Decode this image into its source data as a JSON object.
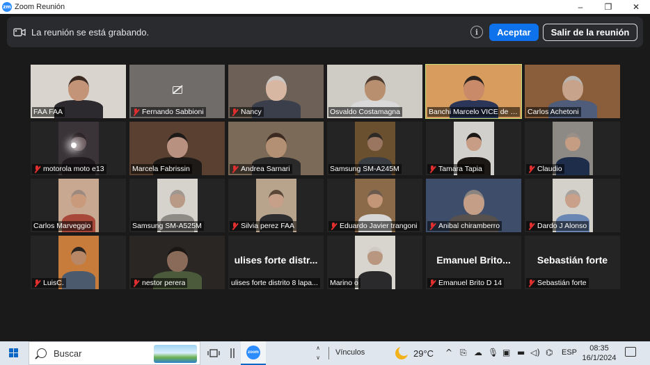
{
  "window": {
    "logo_text": "zm",
    "title": "Zoom Reunión",
    "controls": [
      "–",
      "❐",
      "✕"
    ]
  },
  "recording_bar": {
    "message": "La reunión se está grabando.",
    "info_symbol": "i",
    "accept_label": "Aceptar",
    "leave_label": "Salir de la reunión"
  },
  "participants": [
    {
      "name": "FAA FAA",
      "muted": false,
      "bg": "#d9d4cd",
      "skin": "#c49478",
      "hair": "#3a2a22",
      "shirt": "#2c2a2e"
    },
    {
      "name": "Fernando Sabbioni",
      "muted": true,
      "video_off": true
    },
    {
      "name": "Nancy",
      "muted": true,
      "bg": "#6d6056",
      "skin": "#d7b7a2",
      "hair": "#c9c5c2",
      "shirt": "#3a3f4b"
    },
    {
      "name": "Osvaldo Costamagna",
      "muted": false,
      "bg": "#cfcbc5",
      "skin": "#b8906f",
      "hair": "#4a3a30",
      "shirt": "#d9d9d9"
    },
    {
      "name": "Banchi Marcelo VICE de F...",
      "muted": false,
      "active": true,
      "bg": "#d89c5e",
      "skin": "#c88a68",
      "hair": "#2a2420",
      "shirt": "#2b3557"
    },
    {
      "name": "Carlos Achetoni",
      "muted": false,
      "bg": "#8b5e3b",
      "skin": "#c7a38c",
      "hair": "#b8b4b0",
      "shirt": "#4f5d7a"
    },
    {
      "name": "motorola moto e13",
      "muted": true,
      "bg": "#3a3438",
      "skin": "#6a5a5e",
      "hair": "#2a2226",
      "shirt": "#1f1b1e",
      "light": true
    },
    {
      "name": "Marcela Fabrissin",
      "muted": false,
      "bg": "#5a4030",
      "skin": "#b99180",
      "hair": "#1e1a18",
      "shirt": "#1e1a18"
    },
    {
      "name": "Andrea Sarnari",
      "muted": true,
      "bg": "#7c6a58",
      "skin": "#b38f74",
      "hair": "#3a2a22",
      "shirt": "#2a2a2a"
    },
    {
      "name": "Samsung SM-A245M",
      "muted": false,
      "bg": "#6b5030",
      "skin": "#9a7660",
      "hair": "#2e2a26",
      "shirt": "#3a3d44"
    },
    {
      "name": "Tamara Tapia",
      "muted": true,
      "bg": "#d2d0cc",
      "skin": "#c79d86",
      "hair": "#1b1816",
      "shirt": "#1b1816"
    },
    {
      "name": "Claudio",
      "muted": true,
      "bg": "#8d8a86",
      "skin": "#c49d82",
      "hair": "#9a9088",
      "shirt": "#1e2e4a"
    },
    {
      "name": "Carlos Marveggio",
      "muted": false,
      "bg": "#c8a890",
      "skin": "#c99a7c",
      "hair": "#9c8a80",
      "shirt": "#a8483a"
    },
    {
      "name": "Samsung SM-A525M",
      "muted": false,
      "bg": "#d6d2cc",
      "skin": "#b89a86",
      "hair": "#a09890",
      "shirt": "#8e8a86"
    },
    {
      "name": "Silvia perez FAA",
      "muted": true,
      "bg": "#b8a48c",
      "skin": "#c6a088",
      "hair": "#5a4636",
      "shirt": "#2e2e30"
    },
    {
      "name": "Eduardo Javier trangoni",
      "muted": true,
      "bg": "#8a6a48",
      "skin": "#c49678",
      "hair": "#6b5a4e",
      "shirt": "#d6d6d6"
    },
    {
      "name": "Anibal chiramberro",
      "muted": true,
      "bg": "#3d4d6a",
      "skin": "#c49e86",
      "hair": "#8a8480",
      "shirt": "#56514f"
    },
    {
      "name": "Dardo J Alonso",
      "muted": true,
      "bg": "#d4d0ca",
      "skin": "#c9a08a",
      "hair": "#a8a29e",
      "shirt": "#6a86b2"
    },
    {
      "name": "LuisC.",
      "muted": true,
      "bg": "#c87c3c",
      "skin": "#b88866",
      "hair": "#2a2420",
      "shirt": "#4c5a6e"
    },
    {
      "name": "nestor perera",
      "muted": true,
      "bg": "#2a2624",
      "skin": "#8a6a58",
      "hair": "#1a1614",
      "shirt": "#4a5a3a"
    },
    {
      "name": "ulises forte distrito 8 lapa...",
      "muted": false,
      "video_off": true,
      "big_name": "ulises forte distr..."
    },
    {
      "name": "Marino o",
      "muted": false,
      "bg": "#d8d4ce",
      "skin": "#b89680",
      "hair": "#cfcac4",
      "shirt": "#2a2a2c"
    },
    {
      "name": "Emanuel Brito D 14",
      "muted": true,
      "video_off": true,
      "big_name": "Emanuel Brito..."
    },
    {
      "name": "Sebastián forte",
      "muted": true,
      "video_off": true,
      "big_name": "Sebastián forte"
    }
  ],
  "taskbar": {
    "search_label": "Buscar",
    "zoom_logo_text": "zoom",
    "chevrons": "∧\n∨",
    "links_label": "Vínculos",
    "temperature": "29°C",
    "tray_glyphs": [
      "^",
      "⎘",
      "☁",
      "🎙",
      "▣",
      "▬",
      "◁)",
      "⌬"
    ],
    "language": "ESP",
    "time": "08:35",
    "date": "16/1/2024"
  }
}
